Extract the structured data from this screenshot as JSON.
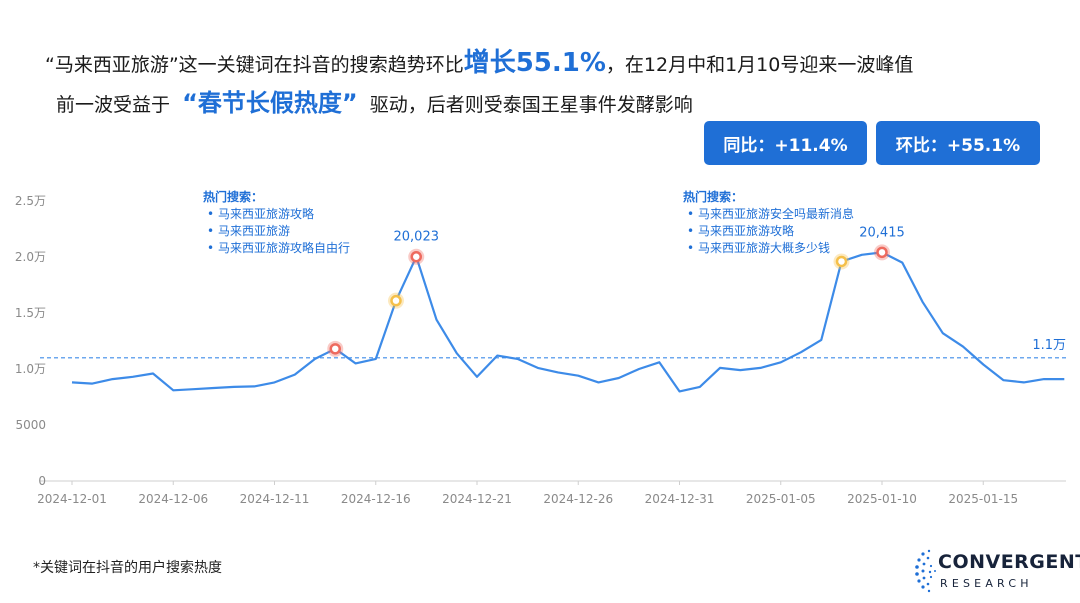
{
  "headline": {
    "line1_pre": "“马来西亚旅游”这一关键词在抖音的搜索趋势环比",
    "line1_em": "增长55.1%",
    "line1_post": "，在12月中和1月10号迎来一波峰值",
    "line2_pre": "前一波受益于",
    "line2_em": "“春节长假热度”",
    "line2_post": "驱动，后者则受泰国王星事件发酵影响"
  },
  "badges": {
    "yoy": "同比：+11.4%",
    "mom": "环比：+55.1%"
  },
  "footnote": "*关键词在抖音的用户搜索热度",
  "logo": {
    "line1": "CONVERGENT",
    "line2": "RESEARCH"
  },
  "colors": {
    "accent": "#1f6fd6",
    "line": "#3d8be8",
    "marker_red": "#ee6a5e",
    "marker_yellow": "#f5c04a"
  },
  "chart_data": {
    "type": "line",
    "series": [
      {
        "values": [
          8800,
          8700,
          9100,
          9300,
          9600,
          8100,
          8200,
          8300,
          8400,
          8450,
          8800,
          9500,
          10900,
          11800,
          10500,
          10900,
          16100,
          20023,
          14400,
          11400,
          9300,
          11200,
          10900,
          10100,
          9700,
          9400,
          8800,
          9200,
          10000,
          10600,
          8000,
          8400,
          10100,
          9900,
          10100,
          10600,
          11500,
          12600,
          19600,
          20200,
          20415,
          19500,
          16000,
          13200,
          12000,
          10400,
          9000,
          8800,
          9100,
          9100
        ]
      }
    ],
    "x_start": "2024-12-01",
    "x_tick_labels": [
      "2024-12-01",
      "2024-12-06",
      "2024-12-11",
      "2024-12-16",
      "2024-12-21",
      "2024-12-26",
      "2024-12-31",
      "2025-01-05",
      "2025-01-10",
      "2025-01-15"
    ],
    "y_tick_labels": [
      "0",
      "5000",
      "1.0万",
      "1.5万",
      "2.0万",
      "2.5万"
    ],
    "ylim": [
      0,
      25000
    ],
    "reference_line": {
      "value": 11000,
      "label": "1.1万"
    },
    "markers": [
      {
        "index": 13,
        "color": "red"
      },
      {
        "index": 16,
        "color": "yellow"
      },
      {
        "index": 17,
        "color": "red",
        "label": "20,023"
      },
      {
        "index": 38,
        "color": "yellow"
      },
      {
        "index": 40,
        "color": "red",
        "label": "20,415"
      }
    ],
    "annotations": [
      {
        "title": "热门搜索：",
        "items": [
          "马来西亚旅游攻略",
          "马来西亚旅游",
          "马来西亚旅游攻略自由行"
        ]
      },
      {
        "title": "热门搜索：",
        "items": [
          "马来西亚旅游安全吗最新消息",
          "马来西亚旅游攻略",
          "马来西亚旅游大概多少钱"
        ]
      }
    ]
  }
}
